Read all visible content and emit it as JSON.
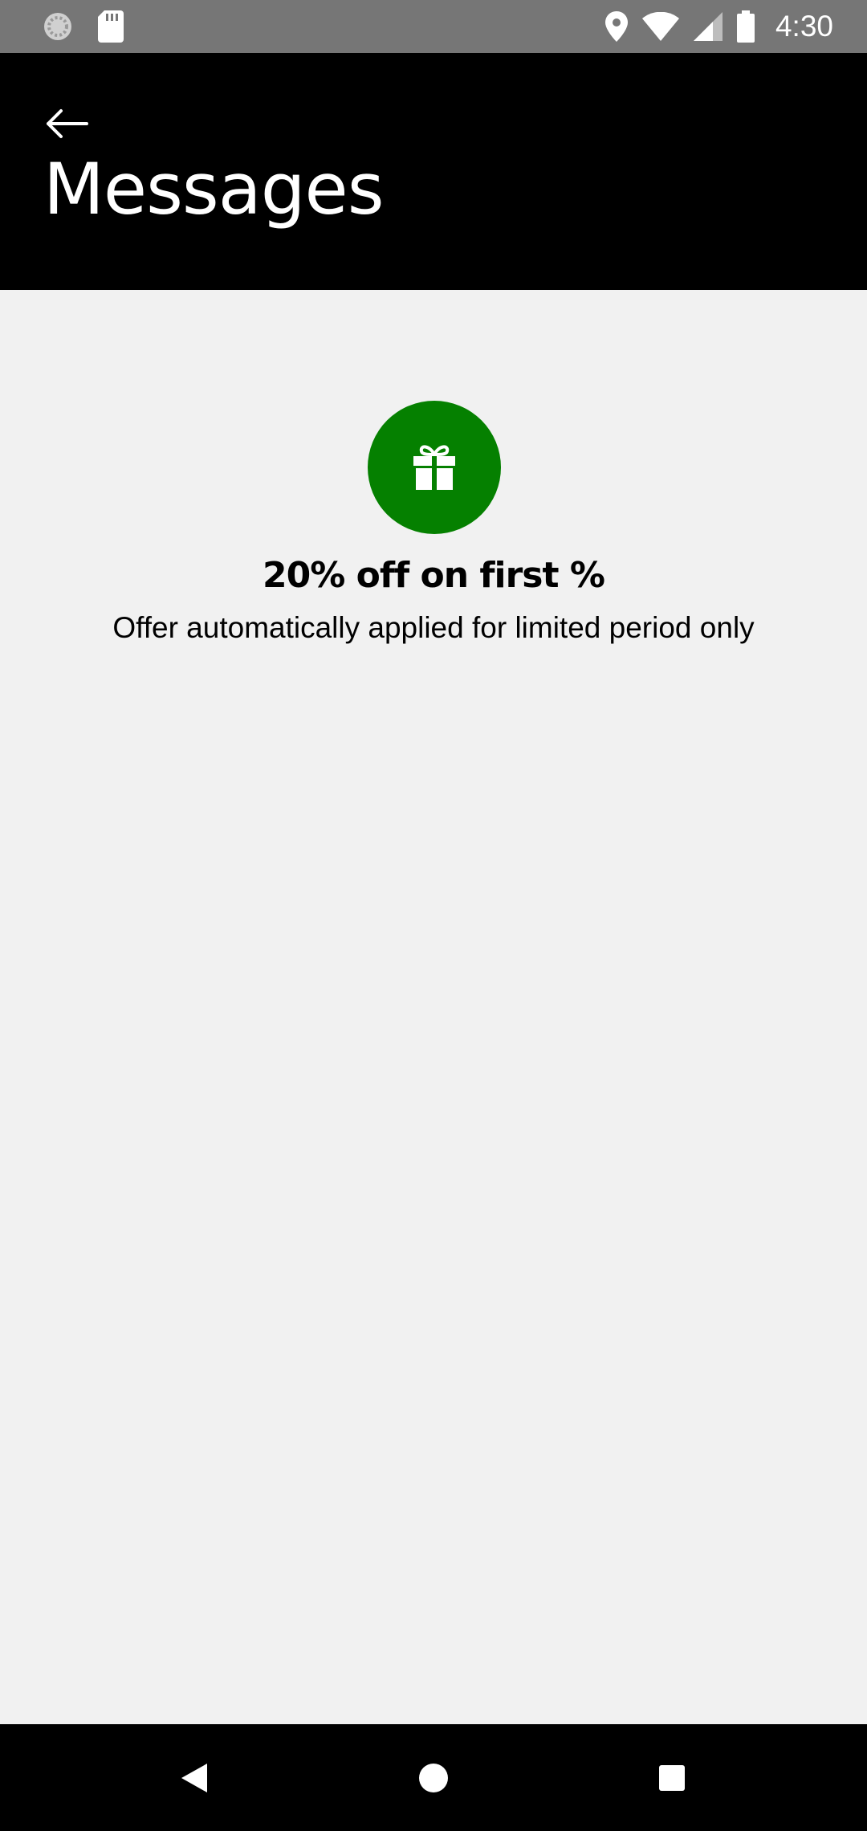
{
  "status_bar": {
    "time": "4:30",
    "icons": [
      "sync-icon",
      "sd-card-icon",
      "location-icon",
      "wifi-icon",
      "signal-icon",
      "battery-icon"
    ]
  },
  "header": {
    "title": "Messages",
    "back_icon": "arrow-left-icon"
  },
  "offer": {
    "icon": "gift-icon",
    "title": "20% off on first %",
    "subtitle": "Offer automatically applied for limited period only"
  },
  "nav_bar": {
    "buttons": [
      "back-triangle-icon",
      "home-circle-icon",
      "recents-square-icon"
    ]
  },
  "colors": {
    "status_bar": "#767676",
    "header": "#000000",
    "background": "#f1f1f1",
    "accent_green": "#058000"
  }
}
